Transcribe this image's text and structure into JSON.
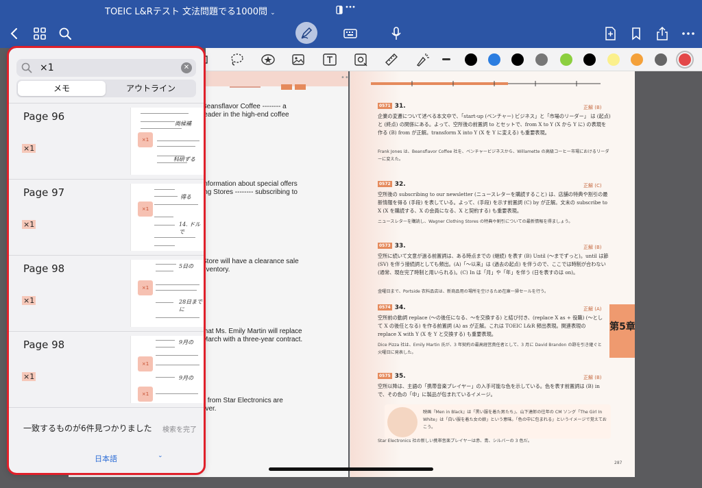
{
  "app": {
    "title": "TOEIC L&Rテスト 文法問題でる1000問",
    "title_chevron": "⌄"
  },
  "colors": {
    "topbar": "#2c55a5",
    "accent_red": "#e0202a",
    "link_blue": "#2f6fd6",
    "hit_highlight": "#f6c8b9"
  },
  "toolbar": {
    "left_icons": [
      "back-chevron-icon",
      "grid-icon",
      "search-icon"
    ],
    "center_icons": [
      "pen-icon",
      "keyboard-icon",
      "microphone-icon"
    ],
    "right_icons": [
      "add-page-icon",
      "bookmark-icon",
      "share-icon",
      "more-icon"
    ]
  },
  "tools": [
    "lasso-icon",
    "shapes-icon",
    "sticker-icon",
    "image-icon",
    "text-icon",
    "screenshot-icon",
    "ruler-icon",
    "laser-pointer-icon"
  ],
  "swatches": [
    "#555555",
    "#000000",
    "#2b7de0",
    "#000000",
    "#777777",
    "#8ccf3f",
    "#000000",
    "#fbf08c",
    "#f4a13a",
    "#666666",
    "#e34848"
  ],
  "search": {
    "query": "×1",
    "placeholder": "検索",
    "segments": {
      "memo": "メモ",
      "outline": "アウトライン"
    },
    "results": [
      {
        "page": "Page 96",
        "hit": "×1",
        "thumb_badge": "×1"
      },
      {
        "page": "Page 97",
        "hit": "×1",
        "thumb_badge": "×1"
      },
      {
        "page": "Page 98",
        "hit": "×1",
        "thumb_badge": "×1"
      },
      {
        "page": "Page 98",
        "hit": "×1",
        "thumb_badge": "×1"
      }
    ],
    "found_text": "一致するものが6件見つかりました",
    "done_text": "検索を完了",
    "language": "日本語",
    "language_chevron": "⌄"
  },
  "left_page": {
    "lines": [
      "Beansflavor Coffee -------- a",
      "leader in the high-end coffee",
      "information about special offers",
      "ing Stores -------- subscribing to",
      "Store will have a clearance sale",
      "nventory.",
      "that Ms. Emily Martin will replace",
      "March with a three-year contract.",
      "s from Star Electronics are",
      "ilver."
    ]
  },
  "right_page": {
    "questions": [
      {
        "num": "31.",
        "tag": "0571",
        "ans": "正解 (B)",
        "body": "企業の変遷について述べる本文中で、「start-up (ベンチャー) ビジネス」と「市場のリーダー」 は (起点) と (終点) の関係にある。よって、空所後の前置詞 to とセットで、from X to Y (X から Y に) の表現を作る (B) from が正解。transform X into Y (X を Y に変える) も重要表現。",
        "note": "Frank Jones は、Beansflavor Coffee 社を、ベンチャービジネスから、Willamette の高級コーヒー市場におけるリーダーに変えた。"
      },
      {
        "num": "32.",
        "tag": "0572",
        "ans": "正解 (C)",
        "body": "空所後の subscribing to our newsletter (ニュースレターを購読すること) は、店舗の特典や割引の最新情報を得る (手段) を表している。よって、(手段) を示す前置詞 (C) by が正解。文末の subscribe to X (X を購読する、X の会員になる、X と契約する) も重要表現。",
        "note": "ニュースレターを購読し、Wagner Clothing Stores の特典や割引についての最新情報を得ましょう。"
      },
      {
        "num": "33.",
        "tag": "0573",
        "ans": "正解 (B)",
        "body": "空所に続いて文意が過る前置詞は、ある時点までの (継続) を表す (B) Until (〜までずっと)。until は節 (SV) を伴う接続詞としても頻出。(A)「〜以来」は (過去の起点) を伴うので、ここでは時制が合わない (通常、現在完了時制と用いられる)。(C) In は「月」や「年」を伴う (日を表すのは on)。",
        "note": "金曜日まで、Portside 衣料品店は、新商品用の場所を空けるため在庫一掃セールを行う。"
      },
      {
        "num": "34.",
        "tag": "0574",
        "ans": "正解 (A)",
        "body": "空所前の動詞 replace (〜の後任になる、〜を交換する) と結び付き、(replace X as + 役職) (〜として X の後任となる) を作る前置詞 (A) as が正解。これは TOEIC L&R 頻出表現。関連表現の replace X with Y (X を Y と交換する) も重要表現。",
        "note": "Dice Pizza 社は、Emily Martin 氏が、3 年契約の最高経営責任者として、3 月に David Brandon の跡を引き継ぐと火曜日に発表した。"
      },
      {
        "num": "35.",
        "tag": "0575",
        "ans": "正解 (B)",
        "body": "空所以降は、主語の「携帯音楽プレイヤー」の入手可能な色を示している。色を表す前置詞は (B) in で、その色の「中」に製品が包まれているイメージ。",
        "note": "Star Electronics 社の新しい携帯音楽プレイヤーは赤、青、シルバーの 3 色だ。"
      }
    ],
    "tex_note": "映画『Men in Black』は「黒い服を着た男たち」、山下達郎の往年の CM ソング「The Girl In White」は「白い服を着た女の娘」という意味。「色の中に包まれる」というイメージで覚えておこう。",
    "chapter": "第5章",
    "page_number": "287"
  }
}
